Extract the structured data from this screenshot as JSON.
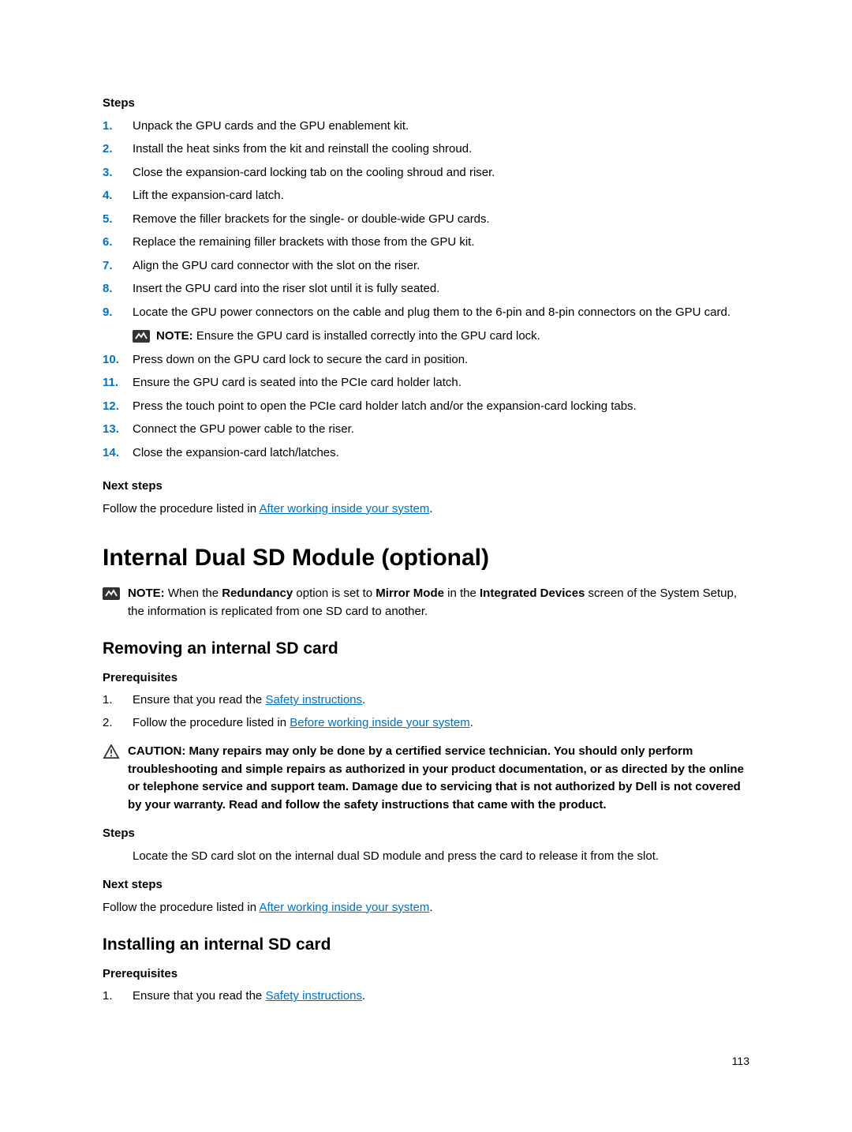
{
  "steps_label": "Steps",
  "steps": [
    "Unpack the GPU cards and the GPU enablement kit.",
    "Install the heat sinks from the kit and reinstall the cooling shroud.",
    "Close the expansion-card locking tab on the cooling shroud and riser.",
    "Lift the expansion-card latch.",
    "Remove the filler brackets for the single- or double-wide GPU cards.",
    "Replace the remaining filler brackets with those from the GPU kit.",
    "Align the GPU card connector with the slot on the riser.",
    "Insert the GPU card into the riser slot until it is fully seated.",
    "Locate the GPU power connectors on the cable and plug them to the 6-pin and 8-pin connectors on the GPU card.",
    "Press down on the GPU card lock to secure the card in position.",
    "Ensure the GPU card is seated into the PCIe card holder latch.",
    "Press the touch point to open the PCIe card holder latch and/or the expansion-card locking tabs.",
    "Connect the GPU power cable to the riser.",
    "Close the expansion-card latch/latches."
  ],
  "step9_note_label": "NOTE: ",
  "step9_note_text": "Ensure the GPU card is installed correctly into the GPU card lock.",
  "next_steps_label": "Next steps",
  "next_steps_text_a": "Follow the procedure listed in ",
  "next_steps_link": "After working inside your system",
  "next_steps_text_b": ".",
  "h1": "Internal Dual SD Module (optional)",
  "h1_note_label": "NOTE: ",
  "h1_note_pre": "When the ",
  "h1_note_b1": "Redundancy",
  "h1_note_mid1": " option is set to ",
  "h1_note_b2": "Mirror Mode",
  "h1_note_mid2": " in the ",
  "h1_note_b3": "Integrated Devices",
  "h1_note_post": " screen of the System Setup, the information is replicated from one SD card to another.",
  "removing_h2": "Removing an internal SD card",
  "prereq_label": "Prerequisites",
  "prereq1_num": "1.",
  "prereq1_a": "Ensure that you read the ",
  "prereq1_link": "Safety instructions",
  "prereq1_b": ".",
  "prereq2_num": "2.",
  "prereq2_a": "Follow the procedure listed in ",
  "prereq2_link": "Before working inside your system",
  "prereq2_b": ".",
  "caution_text": "CAUTION: Many repairs may only be done by a certified service technician. You should only perform troubleshooting and simple repairs as authorized in your product documentation, or as directed by the online or telephone service and support team. Damage due to servicing that is not authorized by Dell is not covered by your warranty. Read and follow the safety instructions that came with the product.",
  "steps2_label": "Steps",
  "steps2_text": "Locate the SD card slot on the internal dual SD module and press the card to release it from the slot.",
  "next_steps2_label": "Next steps",
  "next_steps2_a": "Follow the procedure listed in ",
  "next_steps2_link": "After working inside your system",
  "next_steps2_b": ".",
  "installing_h2": "Installing an internal SD card",
  "prereq2_label": "Prerequisites",
  "inst_prereq1_num": "1.",
  "inst_prereq1_a": "Ensure that you read the ",
  "inst_prereq1_link": "Safety instructions",
  "inst_prereq1_b": ".",
  "page_number": "113"
}
